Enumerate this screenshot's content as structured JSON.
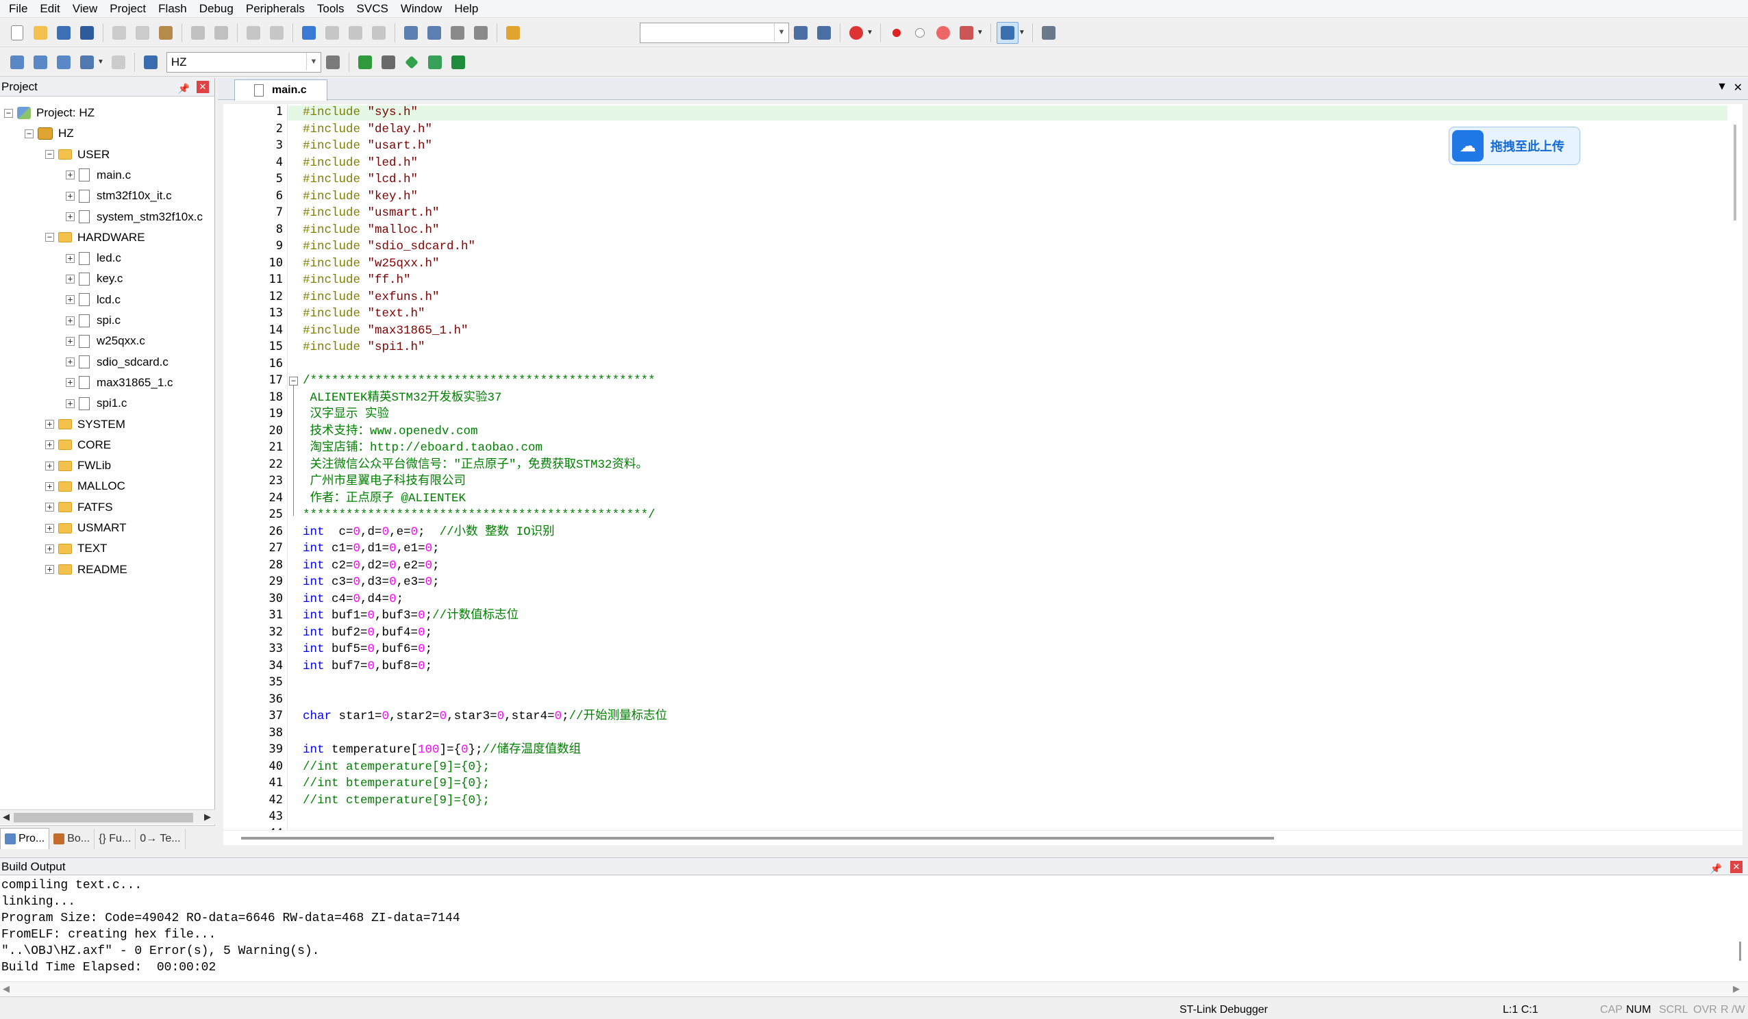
{
  "menu": [
    "File",
    "Edit",
    "View",
    "Project",
    "Flash",
    "Debug",
    "Peripherals",
    "Tools",
    "SVCS",
    "Window",
    "Help"
  ],
  "toolbar2": {
    "target_name": "HZ"
  },
  "project_panel": {
    "title": "Project",
    "root_label": "Project: HZ",
    "target_label": "HZ",
    "groups": [
      {
        "name": "USER",
        "files": [
          "main.c",
          "stm32f10x_it.c",
          "system_stm32f10x.c"
        ]
      },
      {
        "name": "HARDWARE",
        "files": [
          "led.c",
          "key.c",
          "lcd.c",
          "spi.c",
          "w25qxx.c",
          "sdio_sdcard.c",
          "max31865_1.c",
          "spi1.c"
        ]
      },
      {
        "name": "SYSTEM"
      },
      {
        "name": "CORE"
      },
      {
        "name": "FWLib"
      },
      {
        "name": "MALLOC"
      },
      {
        "name": "FATFS"
      },
      {
        "name": "USMART"
      },
      {
        "name": "TEXT"
      },
      {
        "name": "README"
      }
    ],
    "tabs": [
      "Pro...",
      "Bo...",
      "{} Fu...",
      "0→ Te..."
    ]
  },
  "editor": {
    "tab_title": "main.c",
    "upload_label": "拖拽至此上传",
    "lines": [
      [
        [
          "pp",
          "#include "
        ],
        [
          "str",
          "\"sys.h\""
        ]
      ],
      [
        [
          "pp",
          "#include "
        ],
        [
          "str",
          "\"delay.h\""
        ]
      ],
      [
        [
          "pp",
          "#include "
        ],
        [
          "str",
          "\"usart.h\""
        ]
      ],
      [
        [
          "pp",
          "#include "
        ],
        [
          "str",
          "\"led.h\""
        ]
      ],
      [
        [
          "pp",
          "#include "
        ],
        [
          "str",
          "\"lcd.h\""
        ]
      ],
      [
        [
          "pp",
          "#include "
        ],
        [
          "str",
          "\"key.h\""
        ]
      ],
      [
        [
          "pp",
          "#include "
        ],
        [
          "str",
          "\"usmart.h\""
        ]
      ],
      [
        [
          "pp",
          "#include "
        ],
        [
          "str",
          "\"malloc.h\""
        ]
      ],
      [
        [
          "pp",
          "#include "
        ],
        [
          "str",
          "\"sdio_sdcard.h\""
        ]
      ],
      [
        [
          "pp",
          "#include "
        ],
        [
          "str",
          "\"w25qxx.h\""
        ]
      ],
      [
        [
          "pp",
          "#include "
        ],
        [
          "str",
          "\"ff.h\""
        ]
      ],
      [
        [
          "pp",
          "#include "
        ],
        [
          "str",
          "\"exfuns.h\""
        ]
      ],
      [
        [
          "pp",
          "#include "
        ],
        [
          "str",
          "\"text.h\""
        ]
      ],
      [
        [
          "pp",
          "#include "
        ],
        [
          "str",
          "\"max31865_1.h\""
        ]
      ],
      [
        [
          "pp",
          "#include "
        ],
        [
          "str",
          "\"spi1.h\""
        ]
      ],
      [],
      [
        [
          "cm",
          "/************************************************"
        ]
      ],
      [
        [
          "cm",
          " ALIENTEK精英STM32开发板实验37"
        ]
      ],
      [
        [
          "cm",
          " 汉字显示 实验"
        ]
      ],
      [
        [
          "cm",
          " 技术支持：www.openedv.com"
        ]
      ],
      [
        [
          "cm",
          " 淘宝店铺：http://eboard.taobao.com"
        ]
      ],
      [
        [
          "cm",
          " 关注微信公众平台微信号：\"正点原子\"，免费获取STM32资料。"
        ]
      ],
      [
        [
          "cm",
          " 广州市星翼电子科技有限公司"
        ]
      ],
      [
        [
          "cm",
          " 作者：正点原子 @ALIENTEK"
        ]
      ],
      [
        [
          "cm",
          "************************************************/"
        ]
      ],
      [
        [
          "kw",
          "int"
        ],
        [
          "",
          "  c="
        ],
        [
          "num",
          "0"
        ],
        [
          "",
          ",d="
        ],
        [
          "num",
          "0"
        ],
        [
          "",
          ",e="
        ],
        [
          "num",
          "0"
        ],
        [
          "",
          ";  "
        ],
        [
          "cm",
          "//小数 整数 IO识别"
        ]
      ],
      [
        [
          "kw",
          "int"
        ],
        [
          "",
          " c1="
        ],
        [
          "num",
          "0"
        ],
        [
          "",
          ",d1="
        ],
        [
          "num",
          "0"
        ],
        [
          "",
          ",e1="
        ],
        [
          "num",
          "0"
        ],
        [
          "",
          ";"
        ]
      ],
      [
        [
          "kw",
          "int"
        ],
        [
          "",
          " c2="
        ],
        [
          "num",
          "0"
        ],
        [
          "",
          ",d2="
        ],
        [
          "num",
          "0"
        ],
        [
          "",
          ",e2="
        ],
        [
          "num",
          "0"
        ],
        [
          "",
          ";"
        ]
      ],
      [
        [
          "kw",
          "int"
        ],
        [
          "",
          " c3="
        ],
        [
          "num",
          "0"
        ],
        [
          "",
          ",d3="
        ],
        [
          "num",
          "0"
        ],
        [
          "",
          ",e3="
        ],
        [
          "num",
          "0"
        ],
        [
          "",
          ";"
        ]
      ],
      [
        [
          "kw",
          "int"
        ],
        [
          "",
          " c4="
        ],
        [
          "num",
          "0"
        ],
        [
          "",
          ",d4="
        ],
        [
          "num",
          "0"
        ],
        [
          "",
          ";"
        ]
      ],
      [
        [
          "kw",
          "int"
        ],
        [
          "",
          " buf1="
        ],
        [
          "num",
          "0"
        ],
        [
          "",
          ",buf3="
        ],
        [
          "num",
          "0"
        ],
        [
          "",
          ";"
        ],
        [
          "cm",
          "//计数值标志位"
        ]
      ],
      [
        [
          "kw",
          "int"
        ],
        [
          "",
          " buf2="
        ],
        [
          "num",
          "0"
        ],
        [
          "",
          ",buf4="
        ],
        [
          "num",
          "0"
        ],
        [
          "",
          ";"
        ]
      ],
      [
        [
          "kw",
          "int"
        ],
        [
          "",
          " buf5="
        ],
        [
          "num",
          "0"
        ],
        [
          "",
          ",buf6="
        ],
        [
          "num",
          "0"
        ],
        [
          "",
          ";"
        ]
      ],
      [
        [
          "kw",
          "int"
        ],
        [
          "",
          " buf7="
        ],
        [
          "num",
          "0"
        ],
        [
          "",
          ",buf8="
        ],
        [
          "num",
          "0"
        ],
        [
          "",
          ";"
        ]
      ],
      [],
      [],
      [
        [
          "kw",
          "char"
        ],
        [
          "",
          " star1="
        ],
        [
          "num",
          "0"
        ],
        [
          "",
          ",star2="
        ],
        [
          "num",
          "0"
        ],
        [
          "",
          ",star3="
        ],
        [
          "num",
          "0"
        ],
        [
          "",
          ",star4="
        ],
        [
          "num",
          "0"
        ],
        [
          "",
          ";"
        ],
        [
          "cm",
          "//开始测量标志位"
        ]
      ],
      [],
      [
        [
          "kw",
          "int"
        ],
        [
          "",
          " temperature["
        ],
        [
          "num",
          "100"
        ],
        [
          "",
          "]={"
        ],
        [
          "num",
          "0"
        ],
        [
          "",
          "};"
        ],
        [
          "cm",
          "//储存温度值数组"
        ]
      ],
      [
        [
          "cm",
          "//int atemperature[9]={0};"
        ]
      ],
      [
        [
          "cm",
          "//int btemperature[9]={0};"
        ]
      ],
      [
        [
          "cm",
          "//int ctemperature[9]={0};"
        ]
      ],
      [],
      []
    ]
  },
  "build_output": {
    "title": "Build Output",
    "lines": [
      "compiling text.c...",
      "linking...",
      "Program Size: Code=49042 RO-data=6646 RW-data=468 ZI-data=7144",
      "FromELF: creating hex file...",
      "\"..\\OBJ\\HZ.axf\" - 0 Error(s), 5 Warning(s).",
      "Build Time Elapsed:  00:00:02"
    ]
  },
  "status": {
    "debugger": "ST-Link Debugger",
    "position": "L:1 C:1",
    "cap": "CAP",
    "num": "NUM",
    "scrl": "SCRL",
    "ovr": "OVR",
    "rw": "R /W"
  },
  "colors": {
    "keyword": "#0000ff",
    "preprocessor": "#808000",
    "string": "#800000",
    "comment": "#008000",
    "number": "#ff00ff",
    "current_line": "#e5f7e5"
  }
}
